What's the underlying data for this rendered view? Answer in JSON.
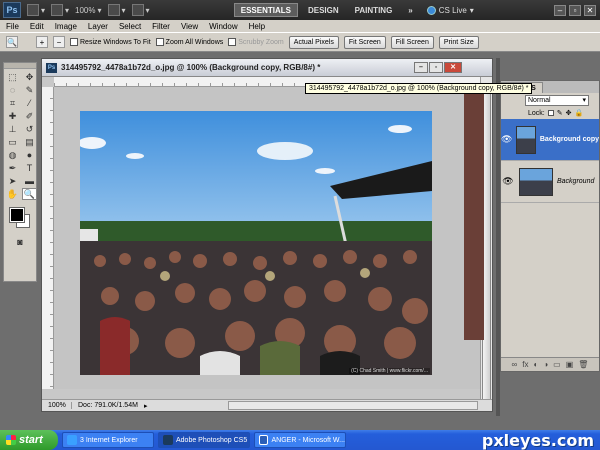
{
  "app": {
    "logo": "Ps",
    "zoom_value": "100%",
    "workspaces": [
      "ESSENTIALS",
      "DESIGN",
      "PAINTING"
    ],
    "more": "»",
    "cslive": "CS Live",
    "window_controls": [
      "–",
      "▫",
      "✕"
    ]
  },
  "menu": [
    "File",
    "Edit",
    "Image",
    "Layer",
    "Select",
    "Filter",
    "View",
    "Window",
    "Help"
  ],
  "options": {
    "resize": "Resize Windows To Fit",
    "zoom_all": "Zoom All Windows",
    "scrubby": "Scrubby Zoom",
    "buttons": [
      "Actual Pixels",
      "Fit Screen",
      "Fill Screen",
      "Print Size"
    ]
  },
  "document": {
    "title": "314495792_4478a1b72d_o.jpg @ 100% (Background copy, RGB/8#) *",
    "zoom": "100%",
    "doc_size": "Doc: 791.0K/1.54M",
    "credit": "(C) Chad Smith | www.flickr.com/..."
  },
  "tooltip": "314495792_4478a1b72d_o.jpg @ 100% (Background copy, RGB/8#) *",
  "layers_panel": {
    "tab": "LAYERS",
    "blend_mode": "Normal",
    "lock": "Lock:",
    "layers": [
      {
        "name": "Background copy",
        "selected": true
      },
      {
        "name": "Background",
        "selected": false
      }
    ]
  },
  "taskbar": {
    "start": "start",
    "tasks": [
      "3 Internet Explorer",
      "Adobe Photoshop CS5",
      "ANGER - Microsoft W..."
    ],
    "watermark": "pxleyes.com"
  },
  "colors": {
    "selection": "#3a6fc8",
    "taskbar": "#245edb",
    "sky": "#5fa3e0"
  }
}
